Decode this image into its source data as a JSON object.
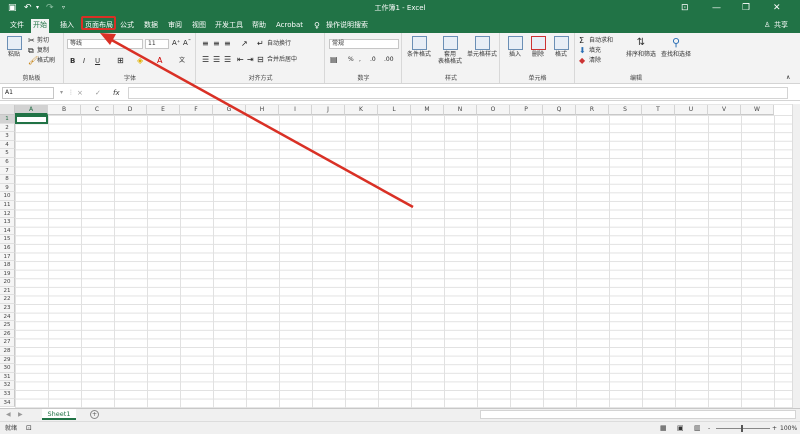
{
  "title_bar": {
    "title": "工作簿1 - Excel",
    "save_icon": "save-icon",
    "undo_icon": "undo-icon",
    "redo_icon": "redo-icon",
    "customize_icon": "customize-icon",
    "ribbon_display_icon": "ribbon-display-icon",
    "minimize_icon": "minimize-icon",
    "restore_icon": "restore-icon",
    "close_icon": "close-icon"
  },
  "menu": {
    "tabs": [
      "文件",
      "开始",
      "插入",
      "页面布局",
      "公式",
      "数据",
      "审阅",
      "视图",
      "帮助",
      "开发工具",
      "帮助",
      "Acrobat"
    ],
    "tell_me": "操作说明搜索",
    "share": "共享",
    "highlight_color": "#d93025"
  },
  "ribbon": {
    "clipboard": {
      "paste": "粘贴",
      "cut": "剪切",
      "copy": "复制",
      "format_painter": "格式刷",
      "label": "剪贴板"
    },
    "font": {
      "name": "等线",
      "size": "11",
      "bold": "B",
      "italic": "I",
      "underline": "U",
      "label": "字体"
    },
    "alignment": {
      "wrap": "自动换行",
      "merge": "合并后居中",
      "label": "对齐方式"
    },
    "number": {
      "format": "常规",
      "percent": "%",
      "comma": ",",
      "label": "数字"
    },
    "styles": {
      "conditional": "条件格式",
      "as_table_1": "套用",
      "as_table_2": "表格格式",
      "cell_styles": "单元格样式",
      "label": "样式"
    },
    "cells": {
      "insert": "插入",
      "delete": "删除",
      "format": "格式",
      "label": "单元格"
    },
    "editing": {
      "autosum": "自动求和",
      "fill": "填充",
      "clear": "清除",
      "sort_filter": "排序和筛选",
      "find_select": "查找和选择",
      "label": "编辑"
    }
  },
  "formula_bar": {
    "name_box": "A1",
    "cancel": "×",
    "enter": "✓",
    "fx": "fx"
  },
  "grid": {
    "columns": [
      "A",
      "B",
      "C",
      "D",
      "E",
      "F",
      "G",
      "H",
      "I",
      "J",
      "K",
      "L",
      "M",
      "N",
      "O",
      "P",
      "Q",
      "R",
      "S",
      "T",
      "U",
      "V",
      "W"
    ],
    "rows": [
      "1",
      "2",
      "3",
      "4",
      "5",
      "6",
      "7",
      "8",
      "9",
      "10",
      "11",
      "12",
      "13",
      "14",
      "15",
      "16",
      "17",
      "18",
      "19",
      "20",
      "21",
      "22",
      "23",
      "24",
      "25",
      "26",
      "27",
      "28",
      "29",
      "30",
      "31",
      "32",
      "33",
      "34"
    ],
    "active_cell": "A1"
  },
  "sheets": {
    "tabs": [
      "Sheet1"
    ],
    "add": "+"
  },
  "status": {
    "ready": "就绪",
    "zoom": "100%",
    "zoom_minus": "-",
    "zoom_plus": "+"
  },
  "annotation": {
    "arrow_color": "#d93025"
  }
}
